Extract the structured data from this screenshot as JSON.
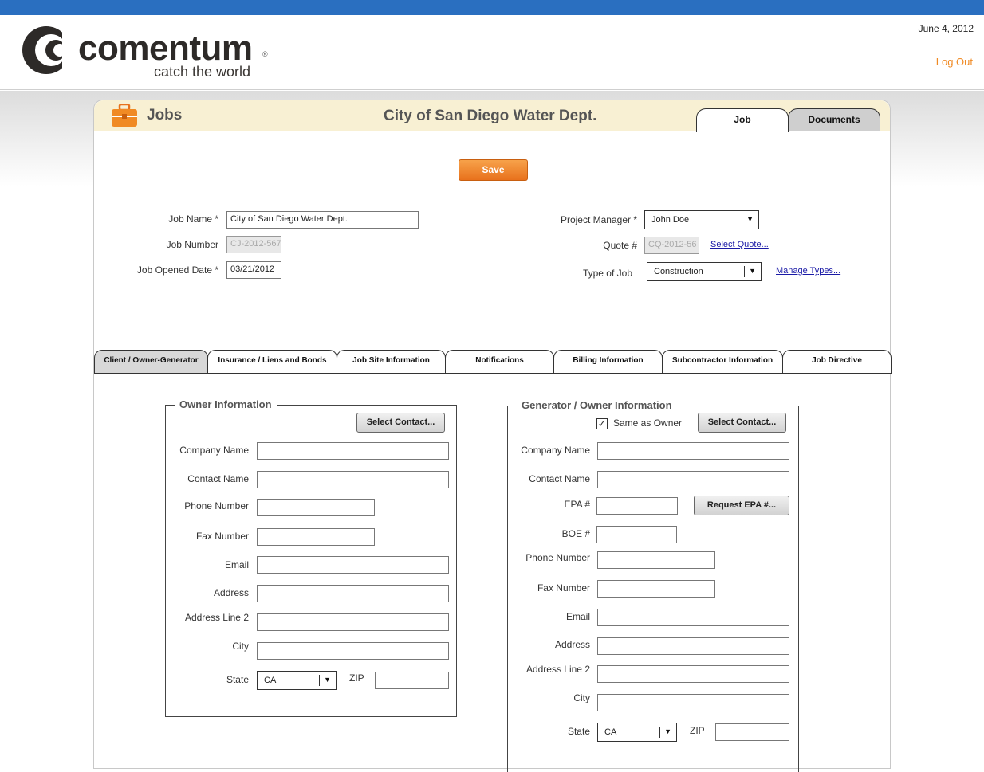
{
  "header": {
    "brand_name": "comentum",
    "brand_tagline": "catch the world",
    "date": "June 4, 2012",
    "logout_label": "Log Out"
  },
  "panel": {
    "section_title": "Jobs",
    "company_title": "City of San Diego Water Dept.",
    "tabs": [
      "Job",
      "Documents"
    ],
    "active_tab": "Job"
  },
  "form": {
    "save_label": "Save",
    "job_name_label": "Job Name *",
    "job_name_value": "City of San Diego Water Dept.",
    "job_number_label": "Job Number",
    "job_number_value": "CJ-2012-567",
    "job_opened_date_label": "Job Opened Date *",
    "job_opened_date_value": "03/21/2012",
    "project_manager_label": "Project Manager *",
    "project_manager_value": "John Doe",
    "quote_label": "Quote #",
    "quote_value": "CQ-2012-56",
    "select_quote_link": "Select Quote...",
    "type_of_job_label": "Type of Job",
    "type_of_job_value": "Construction",
    "manage_types_link": "Manage Types..."
  },
  "section_tabs": [
    "Client / Owner-Generator",
    "Insurance / Liens and Bonds",
    "Job Site Information",
    "Notifications",
    "Billing Information",
    "Subcontractor Information",
    "Job Directive"
  ],
  "owner": {
    "legend": "Owner Information",
    "select_contact_label": "Select Contact...",
    "company_name_label": "Company Name",
    "contact_name_label": "Contact Name",
    "phone_label": "Phone Number",
    "fax_label": "Fax Number",
    "email_label": "Email",
    "address_label": "Address",
    "address2_label": "Address Line 2",
    "city_label": "City",
    "state_label": "State",
    "state_value": "CA",
    "zip_label": "ZIP"
  },
  "generator": {
    "legend": "Generator / Owner Information",
    "same_as_owner_label": "Same as Owner",
    "same_as_owner_checked": true,
    "select_contact_label": "Select Contact...",
    "company_name_label": "Company Name",
    "contact_name_label": "Contact Name",
    "epa_label": "EPA #",
    "request_epa_label": "Request EPA #...",
    "boe_label": "BOE #",
    "phone_label": "Phone Number",
    "fax_label": "Fax Number",
    "email_label": "Email",
    "address_label": "Address",
    "address2_label": "Address Line 2",
    "city_label": "City",
    "state_label": "State",
    "state_value": "CA",
    "zip_label": "ZIP"
  },
  "colors": {
    "top_bar": "#2a6fc0",
    "accent_orange": "#f08a24",
    "header_band": "#f8f0d3",
    "link_blue": "#1a1aa6"
  },
  "icons": {
    "logo": "comentum-c-logo-icon",
    "jobs": "briefcase-icon",
    "dropdown": "dropdown-arrow-icon",
    "checkbox": "checkmark-icon"
  }
}
